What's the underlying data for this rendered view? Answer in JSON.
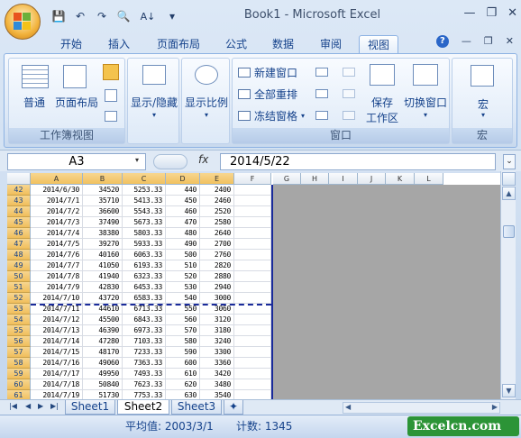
{
  "app": {
    "title": "Book1 - Microsoft Excel"
  },
  "qat": {
    "items": [
      "save-icon",
      "undo-icon",
      "redo-icon",
      "print-preview-icon",
      "sort-icon",
      "customize-icon"
    ],
    "glyphs": [
      "💾",
      "↶",
      "↷",
      "🔍",
      "A↓",
      "▾"
    ]
  },
  "window": {
    "minimize": "—",
    "restore": "❐",
    "close": "✕"
  },
  "tabs": [
    "开始",
    "插入",
    "页面布局",
    "公式",
    "数据",
    "审阅",
    "视图"
  ],
  "active_tab": "视图",
  "ribbon_right": {
    "help": "?",
    "min": "—",
    "restore": "❐",
    "close": "✕"
  },
  "ribbon": {
    "workbook_views": {
      "label": "工作簿视图",
      "normal": "普通",
      "page_layout": "页面布局"
    },
    "show_hide": {
      "label": "显示/隐藏"
    },
    "zoom": {
      "label": "显示比例"
    },
    "window": {
      "label": "窗口",
      "new_window": "新建窗口",
      "arrange_all": "全部重排",
      "freeze_panes": "冻结窗格",
      "save_workspace_1": "保存",
      "save_workspace_2": "工作区",
      "switch_windows": "切换窗口"
    },
    "macros": {
      "label": "宏",
      "macros": "宏"
    }
  },
  "formula_bar": {
    "name_box": "A3",
    "fx": "fx",
    "formula": "2014/5/22"
  },
  "columns": [
    "A",
    "B",
    "C",
    "D",
    "E",
    "F",
    "G",
    "H",
    "I",
    "J",
    "K",
    "L"
  ],
  "rows": [
    {
      "n": "42",
      "a": "2014/6/30",
      "b": "34520",
      "c": "5253.33",
      "d": "440",
      "e": "2400"
    },
    {
      "n": "43",
      "a": "2014/7/1",
      "b": "35710",
      "c": "5413.33",
      "d": "450",
      "e": "2460"
    },
    {
      "n": "44",
      "a": "2014/7/2",
      "b": "36600",
      "c": "5543.33",
      "d": "460",
      "e": "2520"
    },
    {
      "n": "45",
      "a": "2014/7/3",
      "b": "37490",
      "c": "5673.33",
      "d": "470",
      "e": "2580"
    },
    {
      "n": "46",
      "a": "2014/7/4",
      "b": "38380",
      "c": "5803.33",
      "d": "480",
      "e": "2640"
    },
    {
      "n": "47",
      "a": "2014/7/5",
      "b": "39270",
      "c": "5933.33",
      "d": "490",
      "e": "2700"
    },
    {
      "n": "48",
      "a": "2014/7/6",
      "b": "40160",
      "c": "6063.33",
      "d": "500",
      "e": "2760"
    },
    {
      "n": "49",
      "a": "2014/7/7",
      "b": "41050",
      "c": "6193.33",
      "d": "510",
      "e": "2820"
    },
    {
      "n": "50",
      "a": "2014/7/8",
      "b": "41940",
      "c": "6323.33",
      "d": "520",
      "e": "2880"
    },
    {
      "n": "51",
      "a": "2014/7/9",
      "b": "42830",
      "c": "6453.33",
      "d": "530",
      "e": "2940"
    },
    {
      "n": "52",
      "a": "2014/7/10",
      "b": "43720",
      "c": "6583.33",
      "d": "540",
      "e": "3000"
    },
    {
      "n": "53",
      "a": "2014/7/11",
      "b": "44610",
      "c": "6713.33",
      "d": "550",
      "e": "3060"
    },
    {
      "n": "54",
      "a": "2014/7/12",
      "b": "45500",
      "c": "6843.33",
      "d": "560",
      "e": "3120"
    },
    {
      "n": "55",
      "a": "2014/7/13",
      "b": "46390",
      "c": "6973.33",
      "d": "570",
      "e": "3180"
    },
    {
      "n": "56",
      "a": "2014/7/14",
      "b": "47280",
      "c": "7103.33",
      "d": "580",
      "e": "3240"
    },
    {
      "n": "57",
      "a": "2014/7/15",
      "b": "48170",
      "c": "7233.33",
      "d": "590",
      "e": "3300"
    },
    {
      "n": "58",
      "a": "2014/7/16",
      "b": "49060",
      "c": "7363.33",
      "d": "600",
      "e": "3360"
    },
    {
      "n": "59",
      "a": "2014/7/17",
      "b": "49950",
      "c": "7493.33",
      "d": "610",
      "e": "3420"
    },
    {
      "n": "60",
      "a": "2014/7/18",
      "b": "50840",
      "c": "7623.33",
      "d": "620",
      "e": "3480"
    },
    {
      "n": "61",
      "a": "2014/7/19",
      "b": "51730",
      "c": "7753.33",
      "d": "630",
      "e": "3540"
    },
    {
      "n": "62",
      "a": "2014/7/20",
      "b": "52620",
      "c": "7883.33",
      "d": "640",
      "e": "3600"
    },
    {
      "n": "63",
      "a": "2014/7/21",
      "b": "53510",
      "c": "8013.33",
      "d": "650",
      "e": "3660"
    }
  ],
  "sheets": [
    "Sheet1",
    "Sheet2",
    "Sheet3"
  ],
  "active_sheet": "Sheet2",
  "status": {
    "average": "平均值: 2003/3/1",
    "count": "计数: 1345"
  },
  "watermark": "Excelcn.com"
}
